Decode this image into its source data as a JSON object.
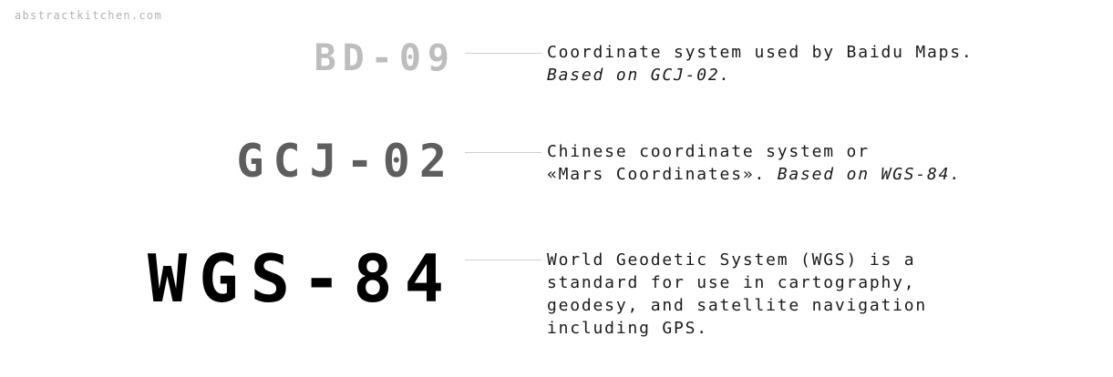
{
  "site_label": "abstractkitchen.com",
  "rows": [
    {
      "name": "BD-09",
      "desc_lines": [
        "Coordinate system used by Baidu Maps."
      ],
      "desc_italic": "Based on GCJ-02.",
      "name_color": "#bdbdbd"
    },
    {
      "name": "GCJ-02",
      "desc_lines": [
        "Chinese coordinate system or",
        "«Mars Coordinates»."
      ],
      "desc_italic": "Based on WGS-84.",
      "name_color": "#5e5e5e"
    },
    {
      "name": "WGS-84",
      "desc_lines": [
        "World Geodetic System (WGS) is a",
        "standard for use in cartography,",
        "geodesy, and satellite navigation",
        "including GPS."
      ],
      "name_color": "#000000"
    }
  ]
}
